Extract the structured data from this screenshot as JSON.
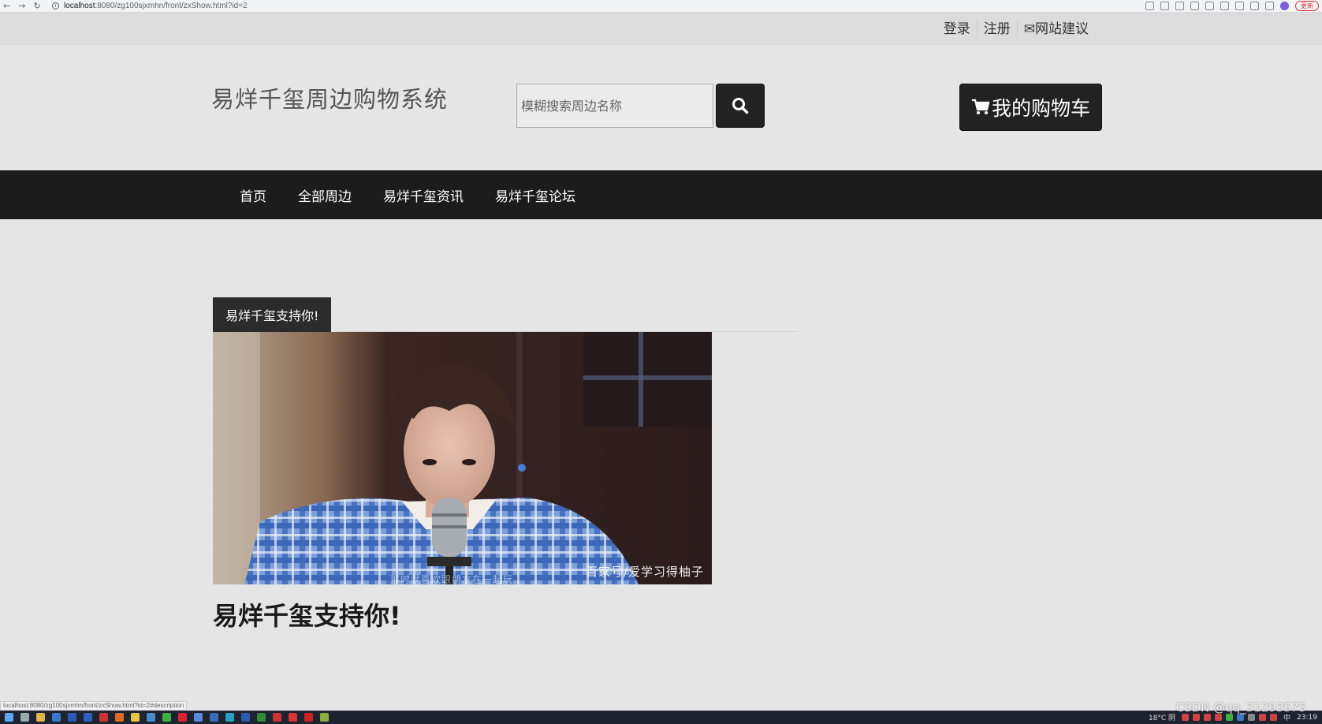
{
  "browser": {
    "host": "localhost",
    "path": ":8080/zg100sjxmhn/front/zxShow.html?id=2",
    "update_label": "更新"
  },
  "topbar": {
    "login": "登录",
    "register": "注册",
    "feedback": "网站建议"
  },
  "header": {
    "site_title": "易烊千玺周边购物系统",
    "search_placeholder": "模糊搜索周边名称",
    "cart_label": "我的购物车"
  },
  "nav": {
    "items": [
      "首页",
      "全部周边",
      "易烊千玺资讯",
      "易烊千玺论坛"
    ]
  },
  "article": {
    "tab_label": "易烊千玺支持你!",
    "image_watermark": "百家号/爱学习得柚子",
    "image_subtitle": "那时就喜欢跟朋友在一起玩",
    "title": "易烊千玺支持你!"
  },
  "status_url": "localhost:8080/zg100sjxmhn/front/zxShow.html?id=2#description",
  "taskbar": {
    "weather": "18°C 阴",
    "ime": "中",
    "time": "23:19"
  },
  "overlay_watermark": "CSDN @qq_31293575",
  "colors": {
    "nav_bg": "#1c1c1c",
    "button_bg": "#222222",
    "page_bg": "#e5e5e5"
  }
}
